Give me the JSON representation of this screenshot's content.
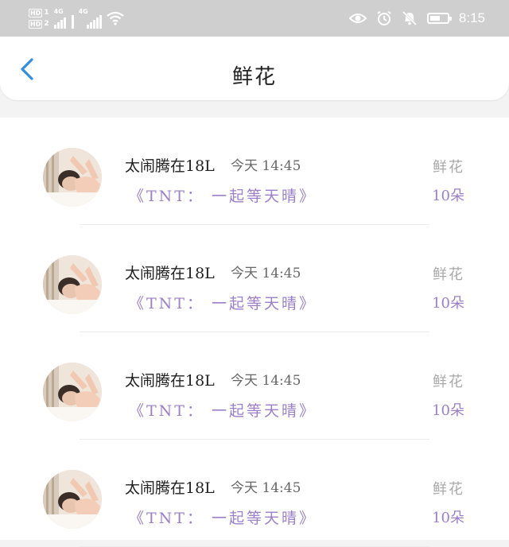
{
  "status_bar": {
    "sim1_label": "HD",
    "sim1_index": "1",
    "sim2_label": "HD",
    "sim2_index": "2",
    "network1": "4G",
    "network2": "4G",
    "time": "8:15",
    "battery_level": 0.6,
    "icons": [
      "eye-icon",
      "alarm-icon",
      "mute-icon",
      "battery-icon"
    ]
  },
  "header": {
    "title": "鲜花",
    "back_icon": "chevron-left-icon",
    "accent_color": "#2f8fe6"
  },
  "list": {
    "items": [
      {
        "name": "太闹腾在18L",
        "time": "今天 14:45",
        "desc": "《TNT： 一起等天晴》",
        "gift": "鲜花",
        "count": "10朵"
      },
      {
        "name": "太闹腾在18L",
        "time": "今天 14:45",
        "desc": "《TNT： 一起等天晴》",
        "gift": "鲜花",
        "count": "10朵"
      },
      {
        "name": "太闹腾在18L",
        "time": "今天 14:45",
        "desc": "《TNT： 一起等天晴》",
        "gift": "鲜花",
        "count": "10朵"
      },
      {
        "name": "太闹腾在18L",
        "time": "今天 14:45",
        "desc": "《TNT： 一起等天晴》",
        "gift": "鲜花",
        "count": "10朵"
      }
    ]
  },
  "colors": {
    "status_bar_bg": "#cfcfcf",
    "purple_text": "#9b7fc8",
    "gray_text": "#a8a8a8"
  }
}
